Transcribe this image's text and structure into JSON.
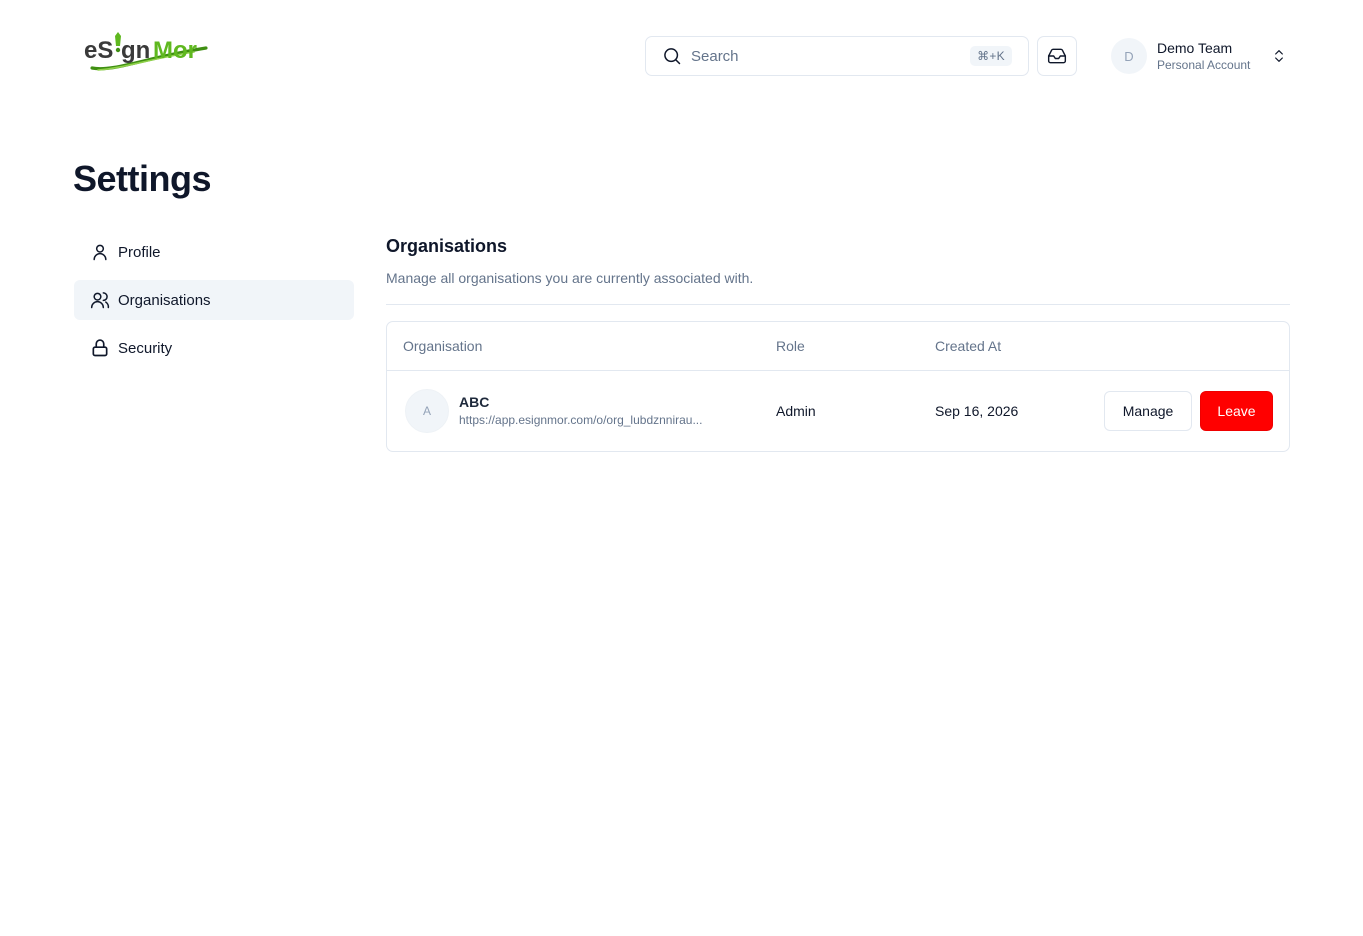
{
  "header": {
    "brand": "eSignMor",
    "search": {
      "placeholder": "Search",
      "shortcut": "⌘+K"
    },
    "account": {
      "initial": "D",
      "name": "Demo Team",
      "type": "Personal Account"
    }
  },
  "page": {
    "title": "Settings"
  },
  "sidebar": {
    "items": [
      {
        "label": "Profile",
        "icon": "user-icon",
        "active": false
      },
      {
        "label": "Organisations",
        "icon": "users-icon",
        "active": true
      },
      {
        "label": "Security",
        "icon": "lock-icon",
        "active": false
      }
    ]
  },
  "main": {
    "title": "Organisations",
    "description": "Manage all organisations you are currently associated with.",
    "table": {
      "columns": [
        "Organisation",
        "Role",
        "Created At"
      ],
      "rows": [
        {
          "initial": "A",
          "name": "ABC",
          "url": "https://app.esignmor.com/o/org_lubdznnirau...",
          "role": "Admin",
          "created_at": "Sep 16, 2026",
          "manage_label": "Manage",
          "leave_label": "Leave"
        }
      ]
    }
  },
  "colors": {
    "brand_dark": "#3a3a3a",
    "brand_green": "#5fb81f",
    "danger": "#ff0000",
    "active_nav_bg": "#f1f5f9"
  }
}
